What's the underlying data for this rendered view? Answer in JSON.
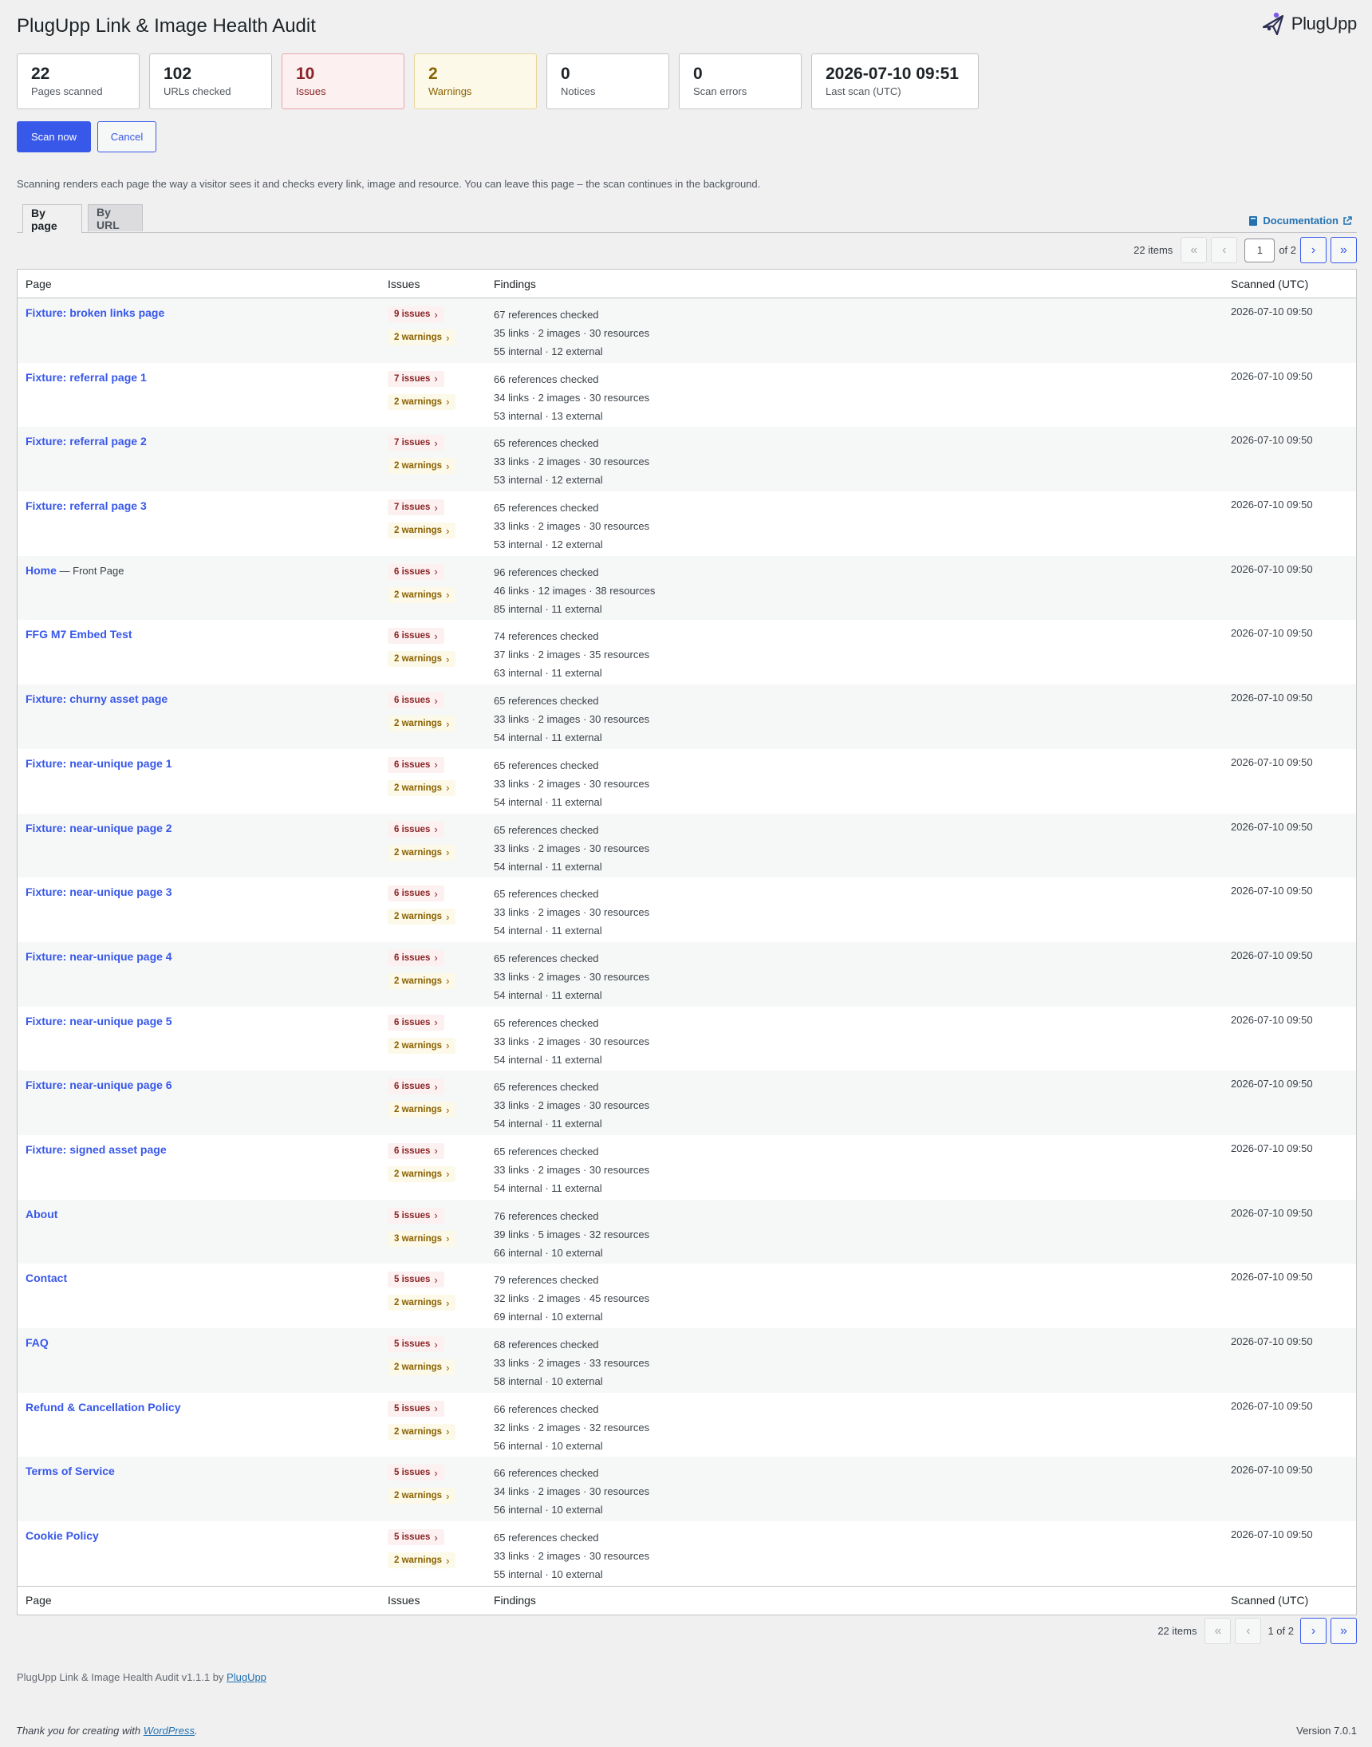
{
  "header": {
    "title": "PlugUpp Link & Image Health Audit",
    "logo_text": "PlugUpp"
  },
  "stats": [
    {
      "value": "22",
      "label": "Pages scanned"
    },
    {
      "value": "102",
      "label": "URLs checked"
    },
    {
      "value": "10",
      "label": "Issues"
    },
    {
      "value": "2",
      "label": "Warnings"
    },
    {
      "value": "0",
      "label": "Notices"
    },
    {
      "value": "0",
      "label": "Scan errors"
    },
    {
      "value": "2026-07-10 09:51",
      "label": "Last scan (UTC)"
    }
  ],
  "actions": {
    "scan_now": "Scan now",
    "cancel": "Cancel"
  },
  "description": "Scanning renders each page the way a visitor sees it and checks every link, image and resource. You can leave this page – the scan continues in the background.",
  "tabs": {
    "by_page": "By page",
    "by_url": "By URL"
  },
  "documentation": "Documentation",
  "pagination": {
    "items": "22 items",
    "current_page": "1",
    "of_total": "of 2",
    "bottom_pages": "1 of 2",
    "first": "«",
    "prev": "‹",
    "next": "›",
    "last": "»"
  },
  "columns": {
    "page": "Page",
    "issues": "Issues",
    "findings": "Findings",
    "scanned": "Scanned (UTC)"
  },
  "rows": [
    {
      "page": "Fixture: broken links page",
      "extra": "",
      "issues": "9 issues",
      "warnings": "2 warnings",
      "refs": "67 references checked",
      "breakdown": "35 links · 2 images · 30 resources",
      "split": "55 internal · 12 external",
      "scanned": "2026-07-10 09:50"
    },
    {
      "page": "Fixture: referral page 1",
      "extra": "",
      "issues": "7 issues",
      "warnings": "2 warnings",
      "refs": "66 references checked",
      "breakdown": "34 links · 2 images · 30 resources",
      "split": "53 internal · 13 external",
      "scanned": "2026-07-10 09:50"
    },
    {
      "page": "Fixture: referral page 2",
      "extra": "",
      "issues": "7 issues",
      "warnings": "2 warnings",
      "refs": "65 references checked",
      "breakdown": "33 links · 2 images · 30 resources",
      "split": "53 internal · 12 external",
      "scanned": "2026-07-10 09:50"
    },
    {
      "page": "Fixture: referral page 3",
      "extra": "",
      "issues": "7 issues",
      "warnings": "2 warnings",
      "refs": "65 references checked",
      "breakdown": "33 links · 2 images · 30 resources",
      "split": "53 internal · 12 external",
      "scanned": "2026-07-10 09:50"
    },
    {
      "page": "Home",
      "extra": " — Front Page",
      "issues": "6 issues",
      "warnings": "2 warnings",
      "refs": "96 references checked",
      "breakdown": "46 links · 12 images · 38 resources",
      "split": "85 internal · 11 external",
      "scanned": "2026-07-10 09:50"
    },
    {
      "page": "FFG M7 Embed Test",
      "extra": "",
      "issues": "6 issues",
      "warnings": "2 warnings",
      "refs": "74 references checked",
      "breakdown": "37 links · 2 images · 35 resources",
      "split": "63 internal · 11 external",
      "scanned": "2026-07-10 09:50"
    },
    {
      "page": "Fixture: churny asset page",
      "extra": "",
      "issues": "6 issues",
      "warnings": "2 warnings",
      "refs": "65 references checked",
      "breakdown": "33 links · 2 images · 30 resources",
      "split": "54 internal · 11 external",
      "scanned": "2026-07-10 09:50"
    },
    {
      "page": "Fixture: near-unique page 1",
      "extra": "",
      "issues": "6 issues",
      "warnings": "2 warnings",
      "refs": "65 references checked",
      "breakdown": "33 links · 2 images · 30 resources",
      "split": "54 internal · 11 external",
      "scanned": "2026-07-10 09:50"
    },
    {
      "page": "Fixture: near-unique page 2",
      "extra": "",
      "issues": "6 issues",
      "warnings": "2 warnings",
      "refs": "65 references checked",
      "breakdown": "33 links · 2 images · 30 resources",
      "split": "54 internal · 11 external",
      "scanned": "2026-07-10 09:50"
    },
    {
      "page": "Fixture: near-unique page 3",
      "extra": "",
      "issues": "6 issues",
      "warnings": "2 warnings",
      "refs": "65 references checked",
      "breakdown": "33 links · 2 images · 30 resources",
      "split": "54 internal · 11 external",
      "scanned": "2026-07-10 09:50"
    },
    {
      "page": "Fixture: near-unique page 4",
      "extra": "",
      "issues": "6 issues",
      "warnings": "2 warnings",
      "refs": "65 references checked",
      "breakdown": "33 links · 2 images · 30 resources",
      "split": "54 internal · 11 external",
      "scanned": "2026-07-10 09:50"
    },
    {
      "page": "Fixture: near-unique page 5",
      "extra": "",
      "issues": "6 issues",
      "warnings": "2 warnings",
      "refs": "65 references checked",
      "breakdown": "33 links · 2 images · 30 resources",
      "split": "54 internal · 11 external",
      "scanned": "2026-07-10 09:50"
    },
    {
      "page": "Fixture: near-unique page 6",
      "extra": "",
      "issues": "6 issues",
      "warnings": "2 warnings",
      "refs": "65 references checked",
      "breakdown": "33 links · 2 images · 30 resources",
      "split": "54 internal · 11 external",
      "scanned": "2026-07-10 09:50"
    },
    {
      "page": "Fixture: signed asset page",
      "extra": "",
      "issues": "6 issues",
      "warnings": "2 warnings",
      "refs": "65 references checked",
      "breakdown": "33 links · 2 images · 30 resources",
      "split": "54 internal · 11 external",
      "scanned": "2026-07-10 09:50"
    },
    {
      "page": "About",
      "extra": "",
      "issues": "5 issues",
      "warnings": "3 warnings",
      "refs": "76 references checked",
      "breakdown": "39 links · 5 images · 32 resources",
      "split": "66 internal · 10 external",
      "scanned": "2026-07-10 09:50"
    },
    {
      "page": "Contact",
      "extra": "",
      "issues": "5 issues",
      "warnings": "2 warnings",
      "refs": "79 references checked",
      "breakdown": "32 links · 2 images · 45 resources",
      "split": "69 internal · 10 external",
      "scanned": "2026-07-10 09:50"
    },
    {
      "page": "FAQ",
      "extra": "",
      "issues": "5 issues",
      "warnings": "2 warnings",
      "refs": "68 references checked",
      "breakdown": "33 links · 2 images · 33 resources",
      "split": "58 internal · 10 external",
      "scanned": "2026-07-10 09:50"
    },
    {
      "page": "Refund & Cancellation Policy",
      "extra": "",
      "issues": "5 issues",
      "warnings": "2 warnings",
      "refs": "66 references checked",
      "breakdown": "32 links · 2 images · 32 resources",
      "split": "56 internal · 10 external",
      "scanned": "2026-07-10 09:50"
    },
    {
      "page": "Terms of Service",
      "extra": "",
      "issues": "5 issues",
      "warnings": "2 warnings",
      "refs": "66 references checked",
      "breakdown": "34 links · 2 images · 30 resources",
      "split": "56 internal · 10 external",
      "scanned": "2026-07-10 09:50"
    },
    {
      "page": "Cookie Policy",
      "extra": "",
      "issues": "5 issues",
      "warnings": "2 warnings",
      "refs": "65 references checked",
      "breakdown": "33 links · 2 images · 30 resources",
      "split": "55 internal · 10 external",
      "scanned": "2026-07-10 09:50"
    }
  ],
  "footer": {
    "plugin_prefix": "PlugUpp Link & Image Health Audit v1.1.1 by ",
    "plugin_link": "PlugUpp",
    "thanks_prefix": "Thank you for creating with ",
    "thanks_link": "WordPress",
    "thanks_suffix": ".",
    "version": "Version 7.0.1"
  },
  "colors": {
    "accent": "#3858e9",
    "issue": "#8a2424",
    "warning": "#8a6100",
    "link": "#2271b1"
  },
  "icons": {
    "logo": "plugupp-logo-icon",
    "docs": "book-icon",
    "external": "external-link-icon",
    "chevron": "chevron-right-icon"
  }
}
